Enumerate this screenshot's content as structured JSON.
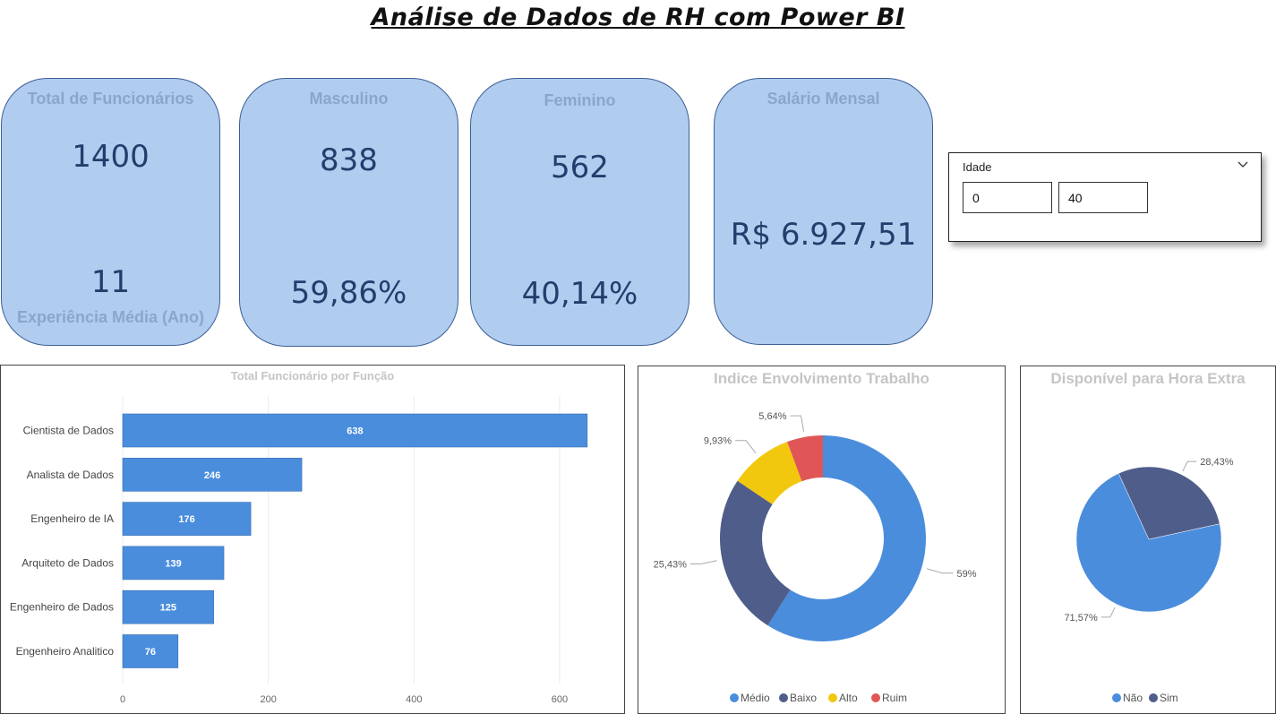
{
  "header": {
    "title": "Análise de Dados de RH  com Power BI"
  },
  "kpis": {
    "total": {
      "label": "Total de Funcionários",
      "value": "1400",
      "secondary_value": "11",
      "secondary_label": "Experiência Média (Ano)"
    },
    "male": {
      "label": "Masculino",
      "value": "838",
      "percent": "59,86%"
    },
    "female": {
      "label": "Feminino",
      "value": "562",
      "percent": "40,14%"
    },
    "salary": {
      "label": "Salário Mensal",
      "value": "R$ 6.927,51"
    }
  },
  "slicer": {
    "label": "Idade",
    "min": "0",
    "max": "40",
    "chevron_icon": "chevron-down-icon"
  },
  "colors": {
    "card_bg": "#b0cdf0",
    "card_text": "#213f6c",
    "bar": "#4a8ddc",
    "medio": "#4a8ddc",
    "baixo": "#4f5d8a",
    "alto": "#f2c80f",
    "ruim": "#e05656",
    "nao": "#4a8ddc",
    "sim": "#4f5d8a"
  },
  "chart_data": [
    {
      "type": "bar",
      "orientation": "horizontal",
      "title": "Total  Funcionário por Função",
      "categories": [
        "Cientista de Dados",
        "Analista de Dados",
        "Engenheiro de IA",
        "Arquiteto de Dados",
        "Engenheiro de Dados",
        "Engenheiro Analitico"
      ],
      "values": [
        638,
        246,
        176,
        139,
        125,
        76
      ],
      "xlim": [
        0,
        680
      ],
      "xticks": [
        0,
        200,
        400,
        600
      ],
      "grid": true
    },
    {
      "type": "pie",
      "donut": true,
      "title": "Indice Envolvimento Trabalho",
      "slices": [
        {
          "name": "Médio",
          "value": 59,
          "label": "59%"
        },
        {
          "name": "Baixo",
          "value": 25.43,
          "label": "25,43%"
        },
        {
          "name": "Alto",
          "value": 9.93,
          "label": "9,93%"
        },
        {
          "name": "Ruim",
          "value": 5.64,
          "label": "5,64%"
        }
      ],
      "legend": "bottom"
    },
    {
      "type": "pie",
      "title": "Disponível para Hora Extra",
      "slices": [
        {
          "name": "Não",
          "value": 71.57,
          "label": "71,57%"
        },
        {
          "name": "Sim",
          "value": 28.43,
          "label": "28,43%"
        }
      ],
      "legend": "bottom"
    }
  ]
}
